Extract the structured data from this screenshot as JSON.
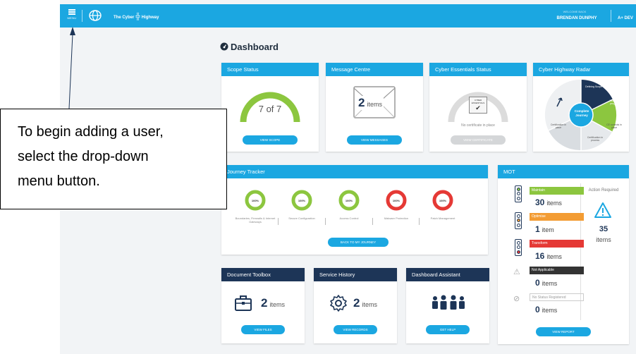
{
  "topbar": {
    "menu_label": "MENU",
    "brand_left": "The Cyber",
    "brand_right": "Highway",
    "user_welcome": "WELCOME BACK",
    "user_name": "BRENDAN DUNPHY",
    "account_partial": "A+ DEV"
  },
  "dashboard": {
    "title": "Dashboard"
  },
  "scope": {
    "title": "Scope Status",
    "value": "7 of 7",
    "button": "VIEW SCOPE"
  },
  "messages": {
    "title": "Message Centre",
    "count": "2",
    "unit": "items",
    "button": "VIEW MESSAGES"
  },
  "ce": {
    "title": "Cyber Essentials Status",
    "badge": "CYBER ESSENTIALS",
    "status": "No certificate in place",
    "button": "VIEW CERTIFICATE"
  },
  "radar": {
    "title": "Cyber Highway Radar",
    "center": "Complete Journey",
    "segments": [
      "Defining Scope",
      "Journey in progress",
      "CE controls in place",
      "Certification in process",
      "Certification in place"
    ]
  },
  "journey": {
    "title": "Journey Tracker",
    "items": [
      {
        "pct": "100%",
        "label": "Boundaries, Firewalls & Internet Gateways",
        "color": "#8cc63f"
      },
      {
        "pct": "100%",
        "label": "Secure Configuration",
        "color": "#8cc63f"
      },
      {
        "pct": "100%",
        "label": "Access Control",
        "color": "#8cc63f"
      },
      {
        "pct": "100%",
        "label": "Malware Protection",
        "color": "#e53935"
      },
      {
        "pct": "100%",
        "label": "Patch Management",
        "color": "#e53935"
      }
    ],
    "button": "BACK TO MY JOURNEY"
  },
  "mot": {
    "title": "MOT",
    "rows": [
      {
        "label": "Maintain",
        "count": "30",
        "unit": "items",
        "color": "#8cc63f"
      },
      {
        "label": "Optimise",
        "count": "1",
        "unit": "item",
        "color": "#f39c33"
      },
      {
        "label": "Transform",
        "count": "16",
        "unit": "items",
        "color": "#e53935"
      },
      {
        "label": "Not Applicable",
        "count": "0",
        "unit": "items",
        "color": "#333333"
      },
      {
        "label": "No Status Registered",
        "count": "0",
        "unit": "items",
        "color": "#ffffff"
      }
    ],
    "action_label": "Action Required",
    "action_count": "35",
    "action_unit": "items",
    "button": "VIEW REPORT"
  },
  "toolbox": {
    "title": "Document Toolbox",
    "count": "2",
    "unit": "items",
    "button": "VIEW FILES"
  },
  "history": {
    "title": "Service History",
    "count": "2",
    "unit": "items",
    "button": "VIEW RECORDS"
  },
  "assistant": {
    "title": "Dashboard Assistant",
    "button": "GET HELP"
  },
  "callout": {
    "line1": "To begin adding a user,",
    "line2": "select the drop-down",
    "line3": "menu button."
  },
  "colors": {
    "primary": "#1ba7e1",
    "navy": "#1d3557",
    "green": "#8cc63f",
    "orange": "#f39c33",
    "red": "#e53935"
  }
}
